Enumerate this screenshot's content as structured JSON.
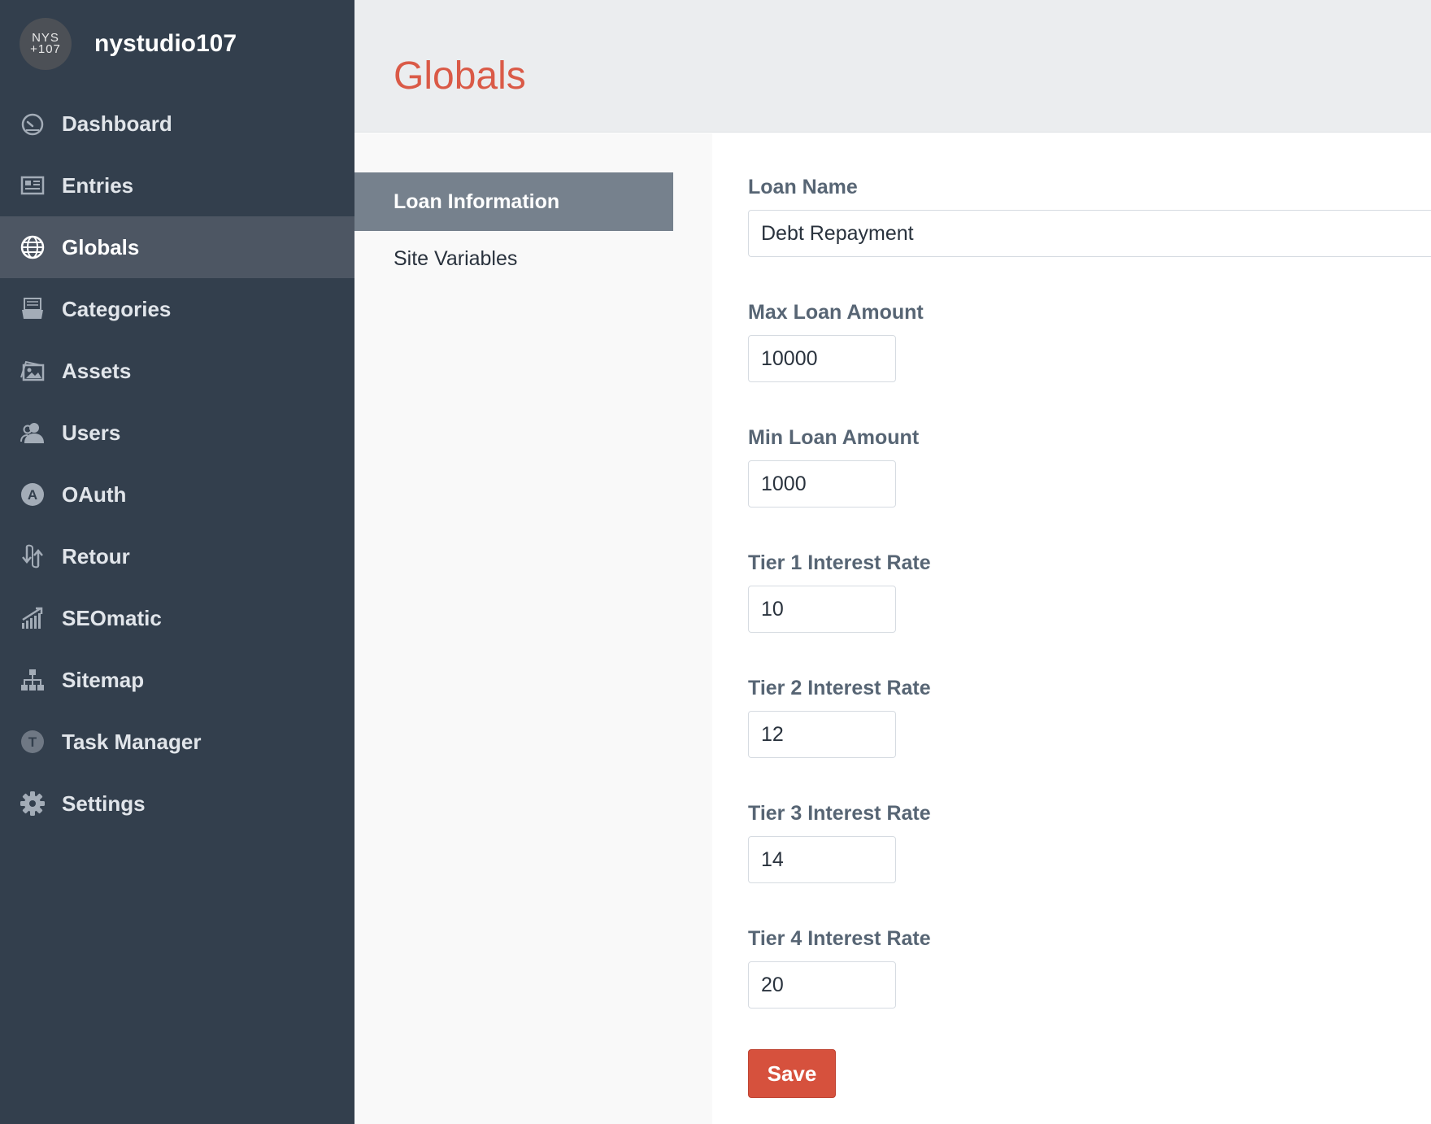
{
  "brand": {
    "logo_line1": "NYS",
    "logo_line2": "+107",
    "name": "nystudio107"
  },
  "nav": {
    "items": [
      {
        "label": "Dashboard",
        "icon": "dashboard-icon",
        "active": false
      },
      {
        "label": "Entries",
        "icon": "entries-icon",
        "active": false
      },
      {
        "label": "Globals",
        "icon": "globe-icon",
        "active": true
      },
      {
        "label": "Categories",
        "icon": "categories-icon",
        "active": false
      },
      {
        "label": "Assets",
        "icon": "assets-icon",
        "active": false
      },
      {
        "label": "Users",
        "icon": "users-icon",
        "active": false
      },
      {
        "label": "OAuth",
        "icon": "oauth-icon",
        "active": false
      },
      {
        "label": "Retour",
        "icon": "retour-icon",
        "active": false
      },
      {
        "label": "SEOmatic",
        "icon": "seomatic-icon",
        "active": false
      },
      {
        "label": "Sitemap",
        "icon": "sitemap-icon",
        "active": false
      },
      {
        "label": "Task Manager",
        "icon": "task-manager-icon",
        "active": false
      },
      {
        "label": "Settings",
        "icon": "gear-icon",
        "active": false
      }
    ]
  },
  "header": {
    "title": "Globals"
  },
  "subnav": {
    "items": [
      {
        "label": "Loan Information",
        "active": true
      },
      {
        "label": "Site Variables",
        "active": false
      }
    ]
  },
  "form": {
    "fields": [
      {
        "label": "Loan Name",
        "value": "Debt Repayment"
      },
      {
        "label": "Max Loan Amount",
        "value": "10000"
      },
      {
        "label": "Min Loan Amount",
        "value": "1000"
      },
      {
        "label": "Tier 1 Interest Rate",
        "value": "10"
      },
      {
        "label": "Tier 2 Interest Rate",
        "value": "12"
      },
      {
        "label": "Tier 3 Interest Rate",
        "value": "14"
      },
      {
        "label": "Tier 4 Interest Rate",
        "value": "20"
      }
    ],
    "save_label": "Save"
  },
  "colors": {
    "sidebar": "#333f4d",
    "accent": "#da5a47",
    "save_button": "#d6513d",
    "subnav_active": "#76818d"
  }
}
